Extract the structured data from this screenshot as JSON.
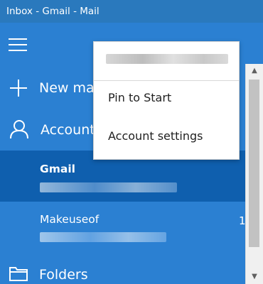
{
  "window": {
    "title": "Inbox - Gmail - Mail"
  },
  "nav": {
    "new_mail_label": "New mail",
    "accounts_label": "Accounts",
    "folders_label": "Folders"
  },
  "accounts": [
    {
      "name": "Gmail",
      "selected": true,
      "unread": ""
    },
    {
      "name": "Makeuseof",
      "selected": false,
      "unread": "1"
    }
  ],
  "context_menu": {
    "items": [
      "Pin to Start",
      "Account settings"
    ]
  },
  "colors": {
    "title_bar": "#2a79bd",
    "sidebar": "#2b80d2",
    "selected_account": "#0f5fae",
    "menu_bg": "#ffffff"
  },
  "icons": [
    "hamburger-menu-icon",
    "plus-icon",
    "person-icon",
    "folder-icon"
  ]
}
